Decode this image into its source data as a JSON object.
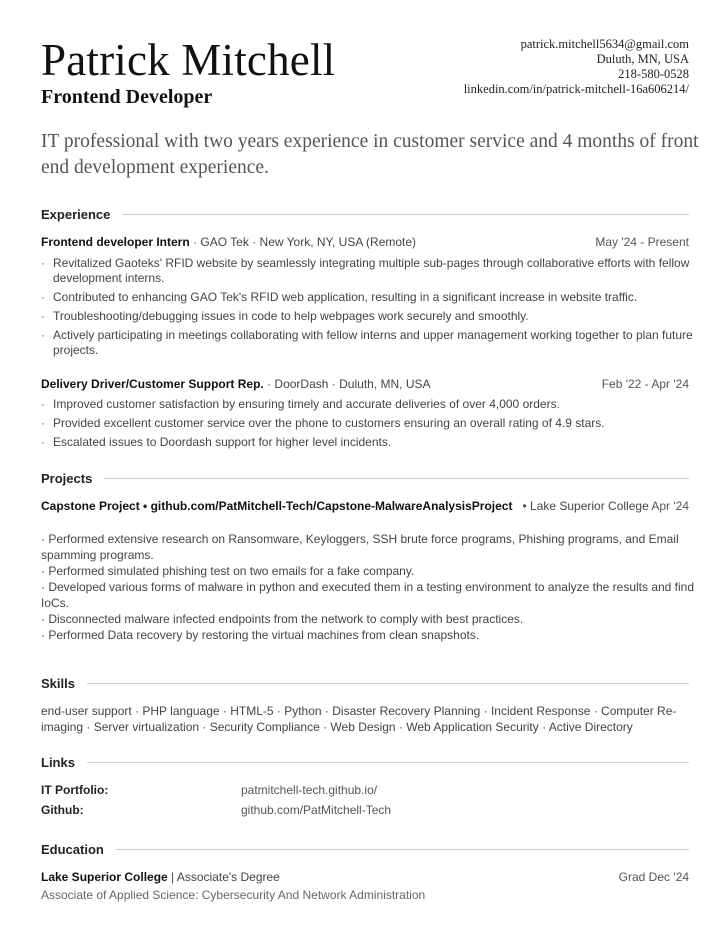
{
  "header": {
    "name": "Patrick Mitchell",
    "role": "Frontend Developer",
    "contact": {
      "email": "patrick.mitchell5634@gmail.com",
      "location": "Duluth, MN, USA",
      "phone": "218-580-0528",
      "linkedin": "linkedin.com/in/patrick-mitchell-16a606214/"
    },
    "summary": "IT professional with two years experience in customer service and 4 months of front end development experience."
  },
  "experience": {
    "title": "Experience",
    "jobs": [
      {
        "position": "Frontend developer Intern",
        "company": "GAO Tek",
        "location": "New York, NY, USA (Remote)",
        "date": "May '24 - Present",
        "bullets": [
          "Revitalized Gaoteks' RFID website by seamlessly integrating multiple sub-pages through collaborative efforts with fellow development interns.",
          "Contributed to enhancing GAO Tek's RFID web application, resulting in a significant increase in website traffic.",
          "Troubleshooting/debugging issues in code to help webpages work securely and smoothly.",
          "Actively participating in meetings collaborating with fellow interns and upper management working together to plan future projects."
        ]
      },
      {
        "position": "Delivery Driver/Customer Support Rep.",
        "company": "DoorDash",
        "location": "Duluth, MN, USA",
        "date": "Feb '22 - Apr '24",
        "bullets": [
          "Improved customer satisfaction by ensuring timely and accurate deliveries of over 4,000 orders.",
          "Provided excellent customer service over the phone to customers ensuring an overall rating of 4.9 stars.",
          "Escalated issues to Doordash support for higher level incidents."
        ]
      }
    ]
  },
  "projects": {
    "title": "Projects",
    "items": [
      {
        "name": "Capstone Project",
        "link": "github.com/PatMitchell-Tech/Capstone-MalwareAnalysisProject",
        "org": "Lake Superior College",
        "date": "Apr '24",
        "lines": [
          "· Performed extensive research on Ransomware, Keyloggers, SSH brute force programs, Phishing programs, and Email spamming programs.",
          "· Performed simulated phishing test on two emails for a fake company.",
          "· Developed various forms of malware in python and executed them in a testing environment to analyze the results and find IoCs.",
          "· Disconnected malware infected endpoints from the network to comply with best practices.",
          "· Performed Data recovery by restoring the virtual machines from clean snapshots."
        ]
      }
    ]
  },
  "skills": {
    "title": "Skills",
    "text": "end-user support · PHP language · HTML-5 · Python · Disaster Recovery Planning · Incident Response · Computer Re-imaging · Server virtualization · Security Compliance · Web Design · Web Application Security · Active Directory"
  },
  "links": {
    "title": "Links",
    "items": [
      {
        "label": "IT Portfolio:",
        "value": "patmitchell-tech.github.io/"
      },
      {
        "label": "Github:",
        "value": "github.com/PatMitchell-Tech"
      }
    ]
  },
  "education": {
    "title": "Education",
    "school": "Lake Superior College",
    "separator": "|",
    "degree": "Associate's Degree",
    "date": "Grad Dec '24",
    "field": "Associate of Applied Science: Cybersecurity And Network Administration"
  },
  "colors": {
    "text": "#2b2b2b",
    "muted": "#555555",
    "rule": "#cfcfcf"
  }
}
